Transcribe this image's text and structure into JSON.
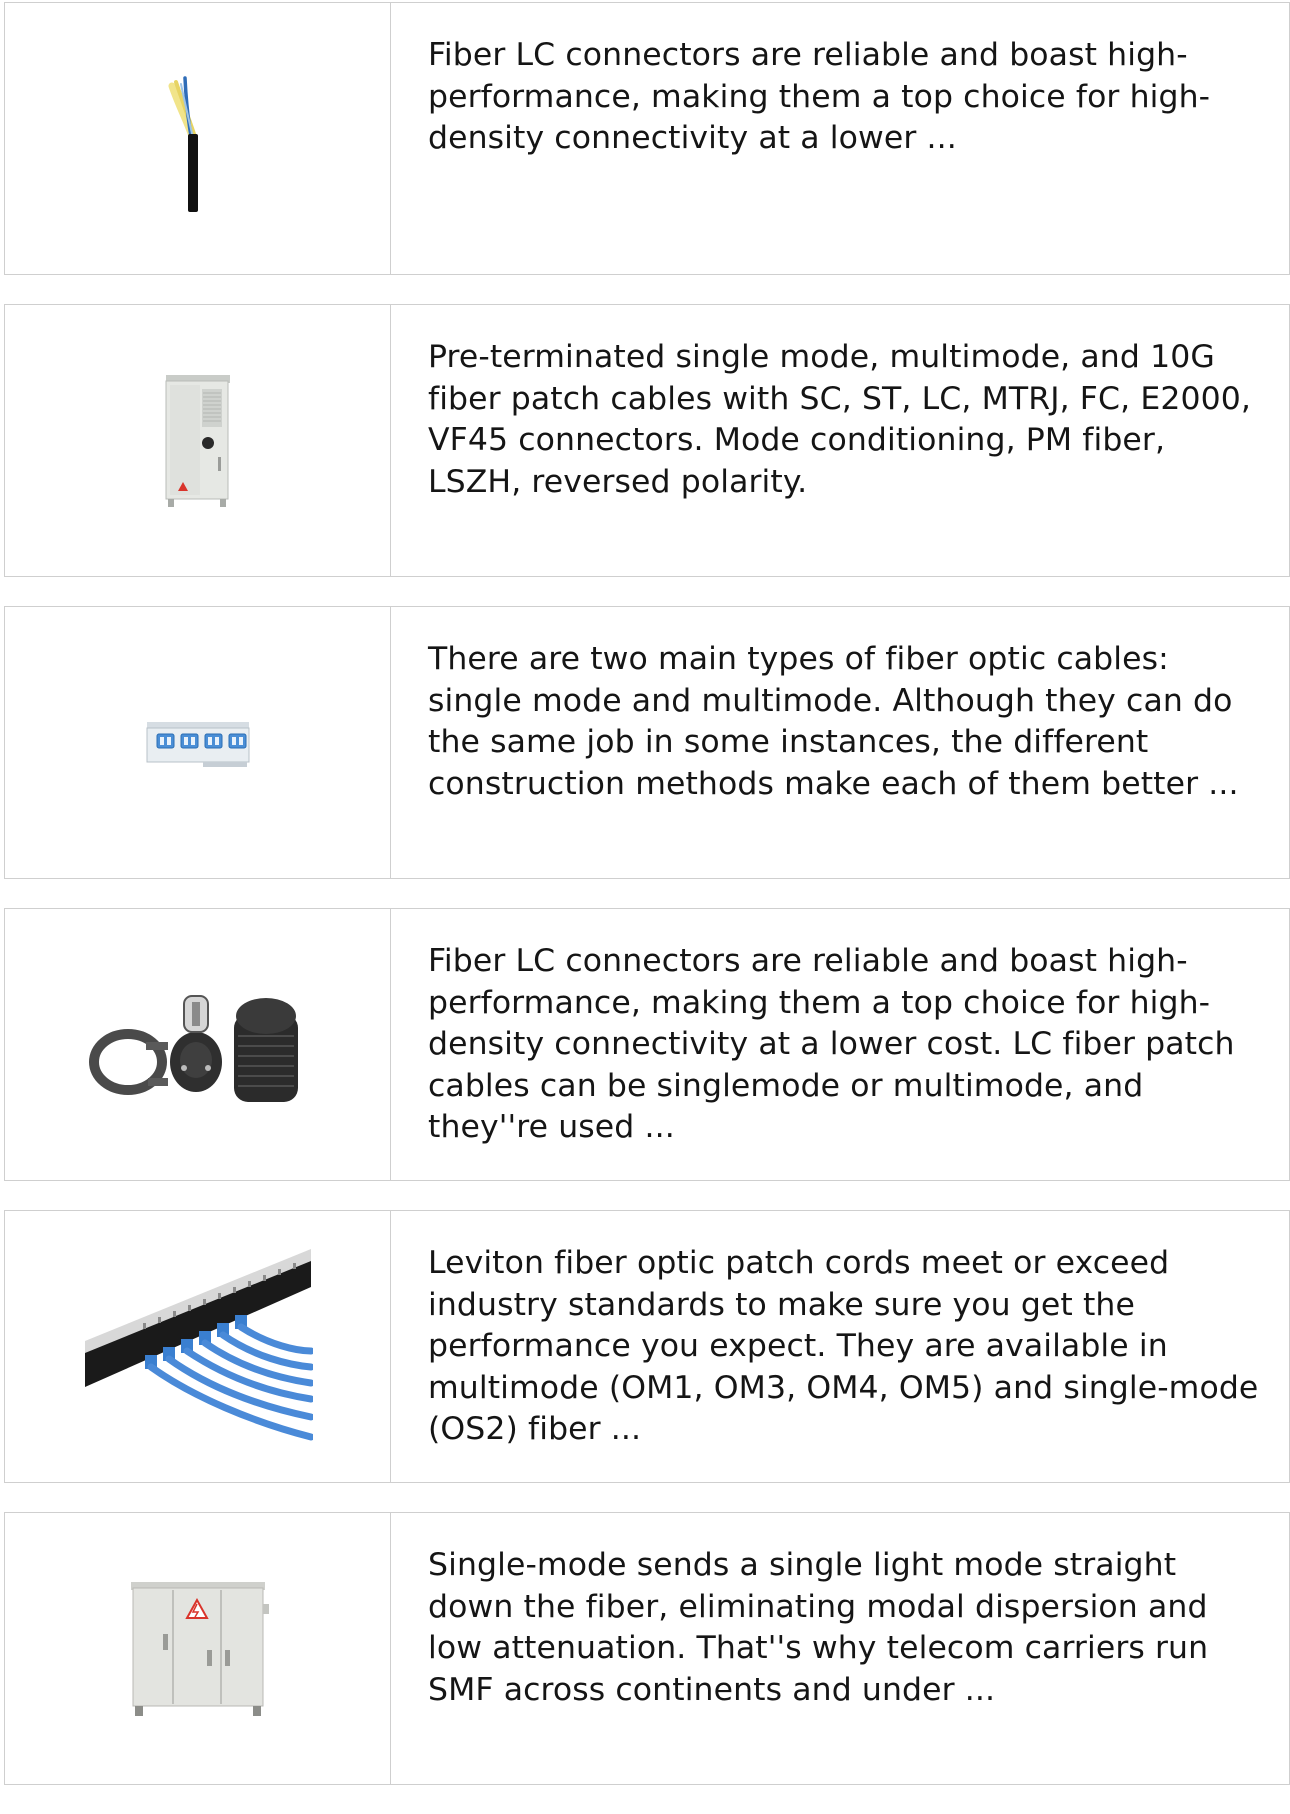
{
  "products": [
    {
      "image_icon": "fiber-cable-strand-icon",
      "description": "Fiber LC connectors are reliable and boast high-performance, making them a top choice for high-density connectivity at a lower ..."
    },
    {
      "image_icon": "outdoor-telecom-cabinet-icon",
      "description": "Pre-terminated single mode, multimode, and 10G fiber patch cables with SC, ST, LC, MTRJ, FC, E2000, VF45 connectors. Mode conditioning, PM fiber, LSZH, reversed polarity."
    },
    {
      "image_icon": "fiber-adapter-panel-icon",
      "description": "There are two main types of fiber optic cables: single mode and multimode. Although they can do the same job in some instances, the different construction methods make each of them better ..."
    },
    {
      "image_icon": "fiber-splice-closure-icon",
      "description": "Fiber LC connectors are reliable and boast high-performance, making them a top choice for high-density connectivity at a lower cost. LC fiber patch cables can be singlemode or multimode, and they''re used ..."
    },
    {
      "image_icon": "patch-panel-with-cables-icon",
      "description": "Leviton fiber optic patch cords meet or exceed industry standards to make sure you get the performance you expect. They are available in multimode (OM1, OM3, OM4, OM5) and single-mode (OS2) fiber ..."
    },
    {
      "image_icon": "electrical-cabinet-icon",
      "description": "Single-mode sends a single light mode straight down the fiber, eliminating modal dispersion and low attenuation. That''s why telecom carriers run SMF across continents and under ..."
    }
  ]
}
